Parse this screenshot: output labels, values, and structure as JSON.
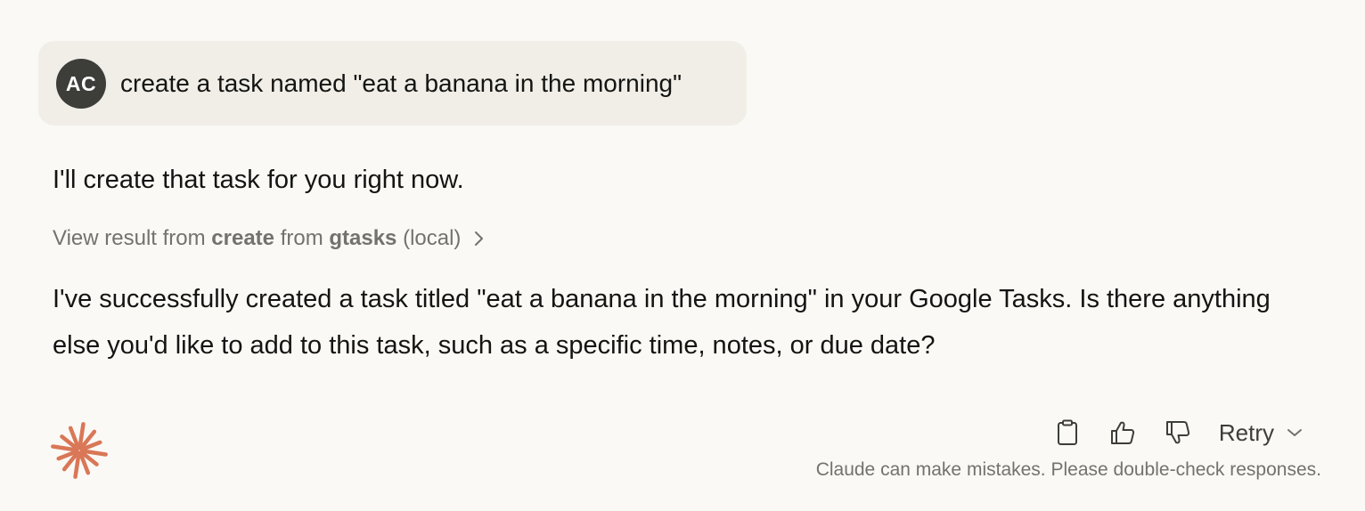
{
  "user_message": {
    "avatar_initials": "AC",
    "text": "create a task named \"eat a banana in the morning\""
  },
  "assistant": {
    "intro": "I'll create that task for you right now.",
    "tool_result": {
      "prefix": "View result from",
      "tool_name": "create",
      "middle": "from",
      "server_name": "gtasks",
      "suffix": "(local)",
      "icon": "chevron-right-icon"
    },
    "body": "I've successfully created a task titled \"eat a banana in the morning\" in your Google Tasks. Is there anything else you'd like to add to this task, such as a specific time, notes, or due date?"
  },
  "footer": {
    "logo_icon": "claude-spark-icon",
    "copy_icon": "clipboard-icon",
    "thumbs_up_icon": "thumbs-up-icon",
    "thumbs_down_icon": "thumbs-down-icon",
    "retry_label": "Retry",
    "disclaimer": "Claude can make mistakes. Please double-check responses."
  },
  "colors": {
    "background": "#faf9f5",
    "user_bubble": "#f0eee6",
    "avatar": "#3d3d3a",
    "brand": "#d97757",
    "muted_text": "#73726c"
  }
}
